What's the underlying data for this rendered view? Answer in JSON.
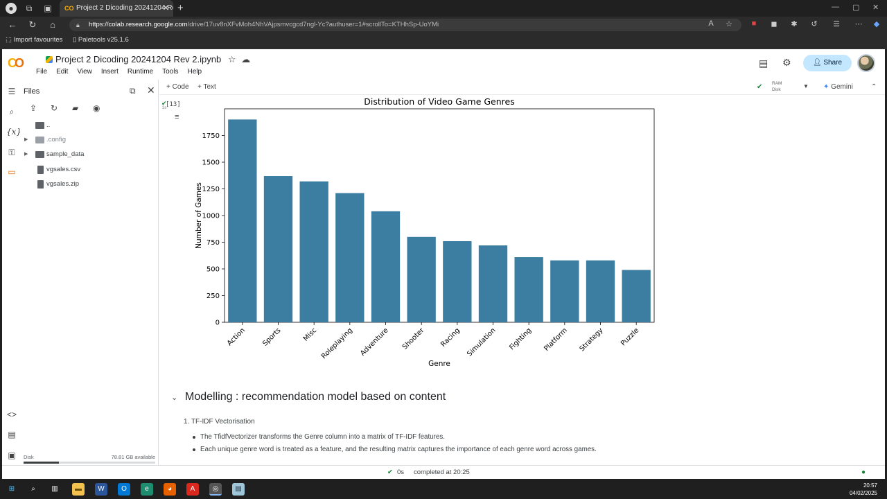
{
  "browser": {
    "tab_title": "Project 2 Dicoding 20241204 Rev",
    "tab_favicon": "CO",
    "url_host": "https://colab.research.google.com",
    "url_path": "/drive/17uv8nXFvMoh4NhVAjpsmvcgcd7ngl-Yc?authuser=1#scrollTo=KTHhSp-UoYMi",
    "favorites": [
      "Import favourites",
      "Paletools v25.1.6"
    ]
  },
  "colab": {
    "logo": "CO",
    "doc_title": "Project 2 Dicoding 20241204 Rev 2.ipynb",
    "menu": [
      "File",
      "Edit",
      "View",
      "Insert",
      "Runtime",
      "Tools",
      "Help"
    ],
    "share_label": "Share",
    "toolbar": {
      "code": "+ Code",
      "text": "+ Text",
      "ram": "RAM",
      "disk": "Disk",
      "gemini": "Gemini"
    }
  },
  "files_panel": {
    "title": "Files",
    "items": [
      {
        "name": "..",
        "type": "parent"
      },
      {
        "name": ".config",
        "type": "folder"
      },
      {
        "name": "sample_data",
        "type": "folder"
      },
      {
        "name": "vgsales.csv",
        "type": "file"
      },
      {
        "name": "vgsales.zip",
        "type": "file"
      }
    ],
    "disk_label": "Disk",
    "disk_available": "78.81 GB available",
    "disk_used_fraction": 0.27
  },
  "cell": {
    "exec_count": "[13]",
    "exec_time": "3s"
  },
  "chart_data": {
    "type": "bar",
    "title": "Distribution of Video Game Genres",
    "xlabel": "Genre",
    "ylabel": "Number of Games",
    "categories": [
      "Action",
      "Sports",
      "Misc",
      "Roleplaying",
      "Adventure",
      "Shooter",
      "Racing",
      "Simulation",
      "Fighting",
      "Platform",
      "Strategy",
      "Puzzle"
    ],
    "values": [
      1900,
      1370,
      1320,
      1210,
      1040,
      800,
      760,
      720,
      610,
      580,
      580,
      490
    ],
    "ylim": [
      0,
      2000
    ],
    "yticks": [
      0,
      250,
      500,
      750,
      1000,
      1250,
      1500,
      1750
    ],
    "bar_color": "#3b7ea1",
    "grid": false
  },
  "markdown": {
    "heading": "Modelling : recommendation model based on content",
    "list_item": "1. TF-IDF Vectorisation",
    "bullets": [
      "The TfidfVectorizer transforms the Genre column into a matrix of TF-IDF features.",
      "Each unique genre word is treated as a feature, and the resulting matrix captures the importance of each genre word across games."
    ]
  },
  "status": {
    "duration": "0s",
    "completed": "completed at 20:25"
  },
  "taskbar": {
    "time": "20:57",
    "date": "04/02/2025"
  }
}
